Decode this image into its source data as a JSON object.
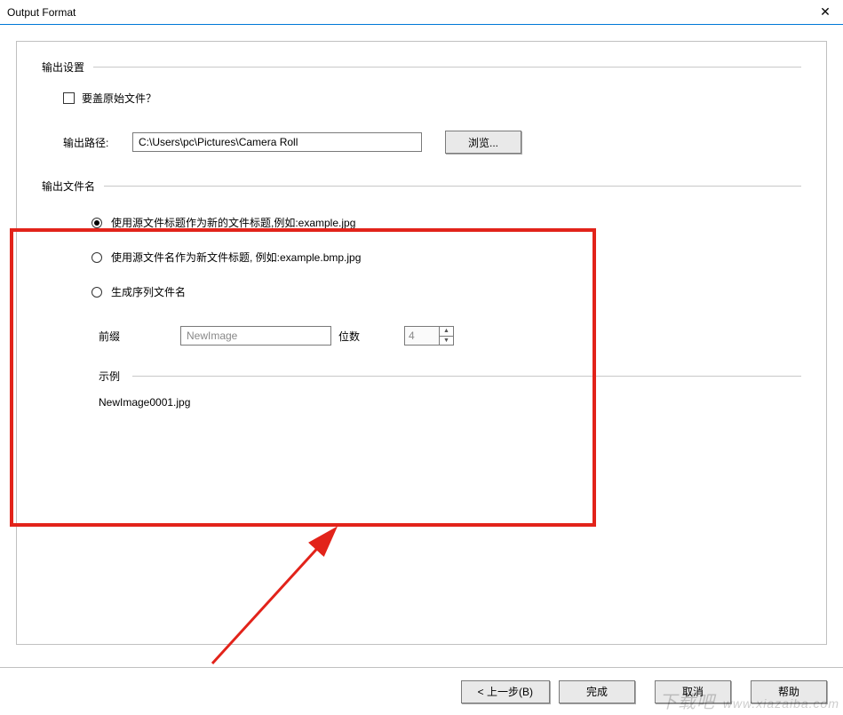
{
  "window": {
    "title": "Output Format"
  },
  "sections": {
    "output_settings": "输出设置",
    "overwrite_label": "要盖原始文件？",
    "output_path_label": "输出路径:",
    "output_path_value": "C:\\Users\\pc\\Pictures\\Camera Roll",
    "browse": "浏览...",
    "output_filename": "输出文件名",
    "radio1": "使用源文件标题作为新的文件标题,例如:example.jpg",
    "radio2": "使用源文件名作为新文件标题, 例如:example.bmp.jpg",
    "radio3": "生成序列文件名",
    "prefix_label": "前缀",
    "prefix_value": "NewImage",
    "digits_label": "位数",
    "digits_value": "4",
    "example_label": "示例",
    "example_value": "NewImage0001.jpg"
  },
  "buttons": {
    "back": "< 上一步(B)",
    "finish": "完成",
    "cancel": "取消",
    "help": "帮助"
  },
  "watermark": {
    "ch": "下载吧",
    "url": "www.xiazaiba.com"
  }
}
